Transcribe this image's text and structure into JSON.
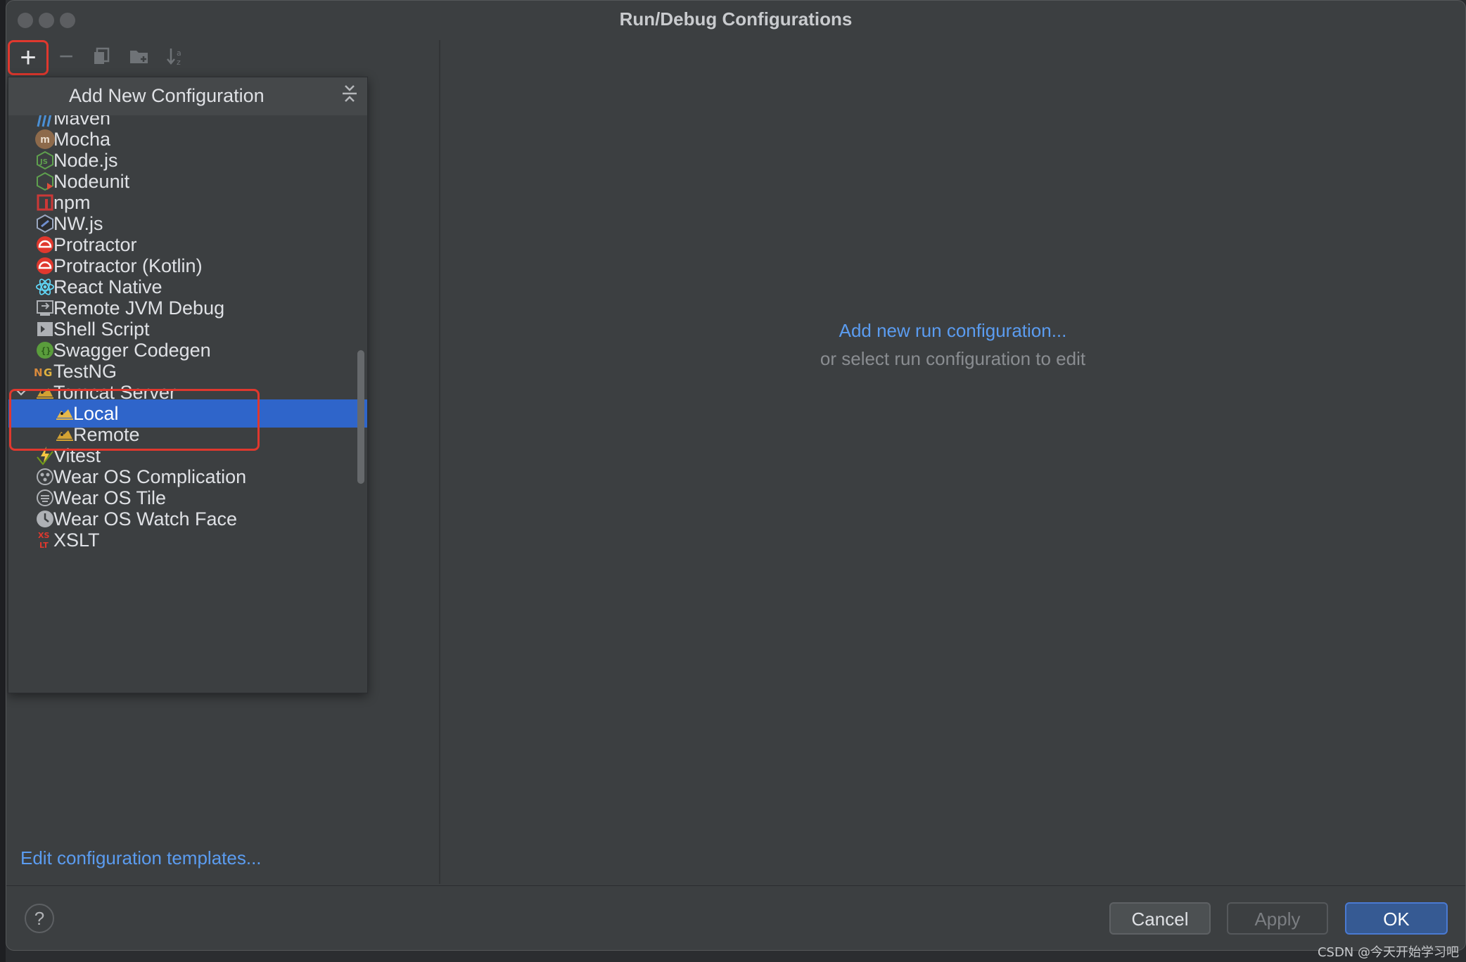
{
  "window": {
    "title": "Run/Debug Configurations"
  },
  "toolbar": {
    "add_symbol": "+",
    "remove_symbol": "−",
    "copy_icon": "copy-icon",
    "folder_icon": "new-folder-icon",
    "sort_icon": "sort-icon"
  },
  "popup": {
    "title": "Add New Configuration",
    "items": [
      {
        "label": "Maven",
        "icon": "maven-icon"
      },
      {
        "label": "Mocha",
        "icon": "mocha-icon"
      },
      {
        "label": "Node.js",
        "icon": "nodejs-icon"
      },
      {
        "label": "Nodeunit",
        "icon": "nodeunit-icon"
      },
      {
        "label": "npm",
        "icon": "npm-icon"
      },
      {
        "label": "NW.js",
        "icon": "nwjs-icon"
      },
      {
        "label": "Protractor",
        "icon": "protractor-icon"
      },
      {
        "label": "Protractor (Kotlin)",
        "icon": "protractor-icon"
      },
      {
        "label": "React Native",
        "icon": "react-icon"
      },
      {
        "label": "Remote JVM Debug",
        "icon": "remote-debug-icon"
      },
      {
        "label": "Shell Script",
        "icon": "shell-icon"
      },
      {
        "label": "Swagger Codegen",
        "icon": "swagger-icon"
      },
      {
        "label": "TestNG",
        "icon": "testng-icon"
      },
      {
        "label": "Tomcat Server",
        "icon": "tomcat-icon"
      },
      {
        "label": "Local",
        "icon": "tomcat-icon"
      },
      {
        "label": "Remote",
        "icon": "tomcat-icon"
      },
      {
        "label": "Vitest",
        "icon": "vitest-icon"
      },
      {
        "label": "Wear OS Complication",
        "icon": "wear-complication-icon"
      },
      {
        "label": "Wear OS Tile",
        "icon": "wear-tile-icon"
      },
      {
        "label": "Wear OS Watch Face",
        "icon": "watch-face-icon"
      },
      {
        "label": "XSLT",
        "icon": "xslt-icon"
      }
    ]
  },
  "right_pane": {
    "add_link": "Add new run configuration...",
    "hint": "or select run configuration to edit"
  },
  "footer": {
    "edit_templates": "Edit configuration templates...",
    "help": "?",
    "cancel": "Cancel",
    "apply": "Apply",
    "ok": "OK"
  },
  "watermark": "CSDN @今天开始学习吧",
  "colors": {
    "accent": "#2f65ca",
    "link": "#5b9cf0",
    "highlight_border": "#e0382e"
  }
}
